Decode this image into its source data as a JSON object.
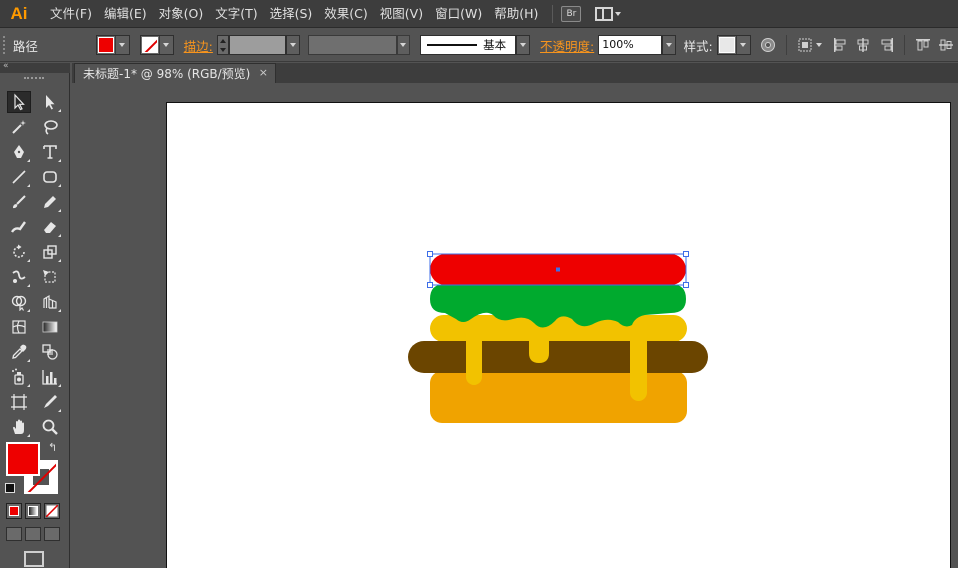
{
  "app": {
    "logo": "Ai"
  },
  "menu": [
    "文件(F)",
    "编辑(E)",
    "对象(O)",
    "文字(T)",
    "选择(S)",
    "效果(C)",
    "视图(V)",
    "窗口(W)",
    "帮助(H)"
  ],
  "bridge_label": "Br",
  "control": {
    "selection_label": "路径",
    "stroke_label": "描边:",
    "stroke_profile": "基本",
    "opacity_label": "不透明度:",
    "opacity_value": "100%",
    "style_label": "样式:"
  },
  "tools_panel": {
    "collapse": "«",
    "swap": "↰"
  },
  "document": {
    "tab_title": "未标题-1* @ 98% (RGB/预览)",
    "close": "×"
  },
  "colors": {
    "fill": "#ee0000",
    "bun_top": "#ee0000",
    "lettuce": "#00aa2e",
    "cheese": "#f2c200",
    "patty": "#6b4500",
    "bun_bottom": "#f0a300",
    "selection": "#3d6ee8"
  },
  "icons": {
    "tools": [
      "selection-tool-icon",
      "direct-selection-tool-icon",
      "magic-wand-tool-icon",
      "lasso-tool-icon",
      "pen-tool-icon",
      "type-tool-icon",
      "line-segment-tool-icon",
      "rounded-rectangle-tool-icon",
      "paintbrush-tool-icon",
      "pencil-tool-icon",
      "blob-brush-tool-icon",
      "eraser-tool-icon",
      "rotate-tool-icon",
      "scale-tool-icon",
      "warp-tool-icon",
      "free-transform-tool-icon",
      "shape-builder-tool-icon",
      "perspective-grid-tool-icon",
      "mesh-tool-icon",
      "gradient-tool-icon",
      "eyedropper-tool-icon",
      "blend-tool-icon",
      "symbol-sprayer-tool-icon",
      "column-graph-tool-icon",
      "artboard-tool-icon",
      "slice-tool-icon",
      "hand-tool-icon",
      "zoom-tool-icon"
    ]
  }
}
